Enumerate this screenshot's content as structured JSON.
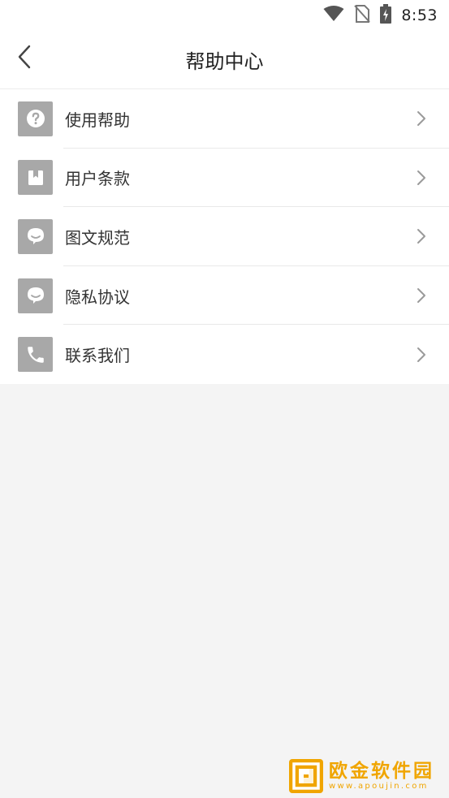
{
  "status_bar": {
    "time": "8:53",
    "icons": [
      "wifi-icon",
      "no-sim-icon",
      "battery-charging-icon"
    ]
  },
  "header": {
    "title": "帮助中心",
    "back_icon": "chevron-left-icon"
  },
  "menu": {
    "items": [
      {
        "label": "使用帮助",
        "icon": "question-icon"
      },
      {
        "label": "用户条款",
        "icon": "bookmark-icon"
      },
      {
        "label": "图文规范",
        "icon": "chat-bubble-icon"
      },
      {
        "label": "隐私协议",
        "icon": "chat-bubble-icon"
      },
      {
        "label": "联系我们",
        "icon": "phone-icon"
      }
    ],
    "arrow_icon": "chevron-right-icon"
  },
  "watermark": {
    "title": "欧金软件园",
    "url": "www.apoujin.com",
    "color": "#f0a500"
  },
  "colors": {
    "icon_bg": "#a8a8a8",
    "page_bg": "#f4f4f4",
    "surface": "#ffffff"
  }
}
